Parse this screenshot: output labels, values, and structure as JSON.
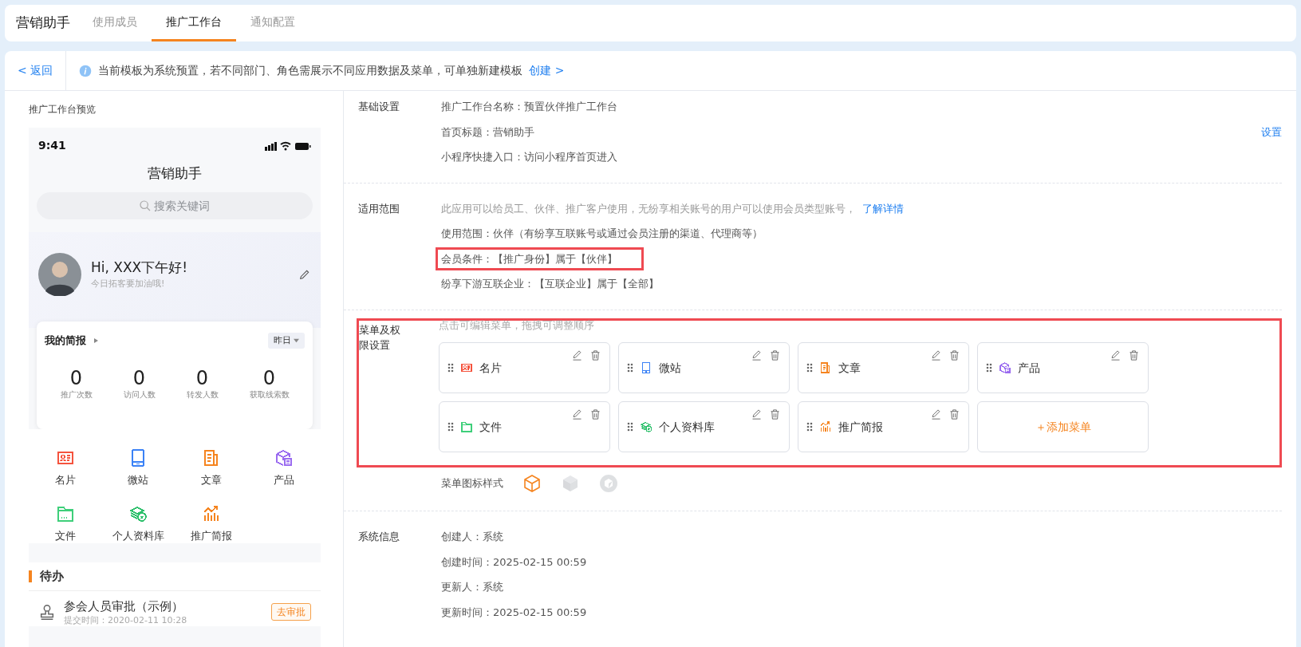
{
  "app_title": "营销助手",
  "tabs": [
    {
      "label": "使用成员",
      "selected": false
    },
    {
      "label": "推广工作台",
      "selected": true
    },
    {
      "label": "通知配置",
      "selected": false
    }
  ],
  "back": "< 返回",
  "notice": {
    "text": "当前模板为系统预置，若不同部门、角色需展示不同应用数据及菜单，可单独新建模板",
    "link": "创建 >"
  },
  "preview": {
    "label": "推广工作台预览",
    "time": "9:41",
    "title": "营销助手",
    "search_placeholder": "搜索关键词",
    "greeting": "Hi, XXX下午好!",
    "subtitle": "今日拓客要加油哦!",
    "report": {
      "title": "我的简报",
      "period": "昨日",
      "stats": [
        {
          "value": "0",
          "label": "推广次数"
        },
        {
          "value": "0",
          "label": "访问人数"
        },
        {
          "value": "0",
          "label": "转发人数"
        },
        {
          "value": "0",
          "label": "获取线索数"
        }
      ]
    },
    "menu": [
      {
        "label": "名片",
        "kind": "card",
        "color": "#f5533d"
      },
      {
        "label": "微站",
        "kind": "phone",
        "color": "#3b82f6"
      },
      {
        "label": "文章",
        "kind": "article",
        "color": "#f5841f"
      },
      {
        "label": "产品",
        "kind": "product",
        "color": "#9b6cf0"
      },
      {
        "label": "文件",
        "kind": "folder",
        "color": "#3ecf7a"
      },
      {
        "label": "个人资料库",
        "kind": "library",
        "color": "#2bbf6a"
      },
      {
        "label": "推广简报",
        "kind": "chart",
        "color": "#f5841f"
      }
    ],
    "todo": {
      "title": "待办",
      "items": [
        {
          "title": "参会人员审批（示例）",
          "time": "提交时间：2020-02-11 10:28",
          "action": "去审批"
        }
      ]
    }
  },
  "basic": {
    "title": "基础设置",
    "lines": [
      "推广工作台名称：预置伙伴推广工作台",
      "首页标题：营销助手",
      "小程序快捷入口：访问小程序首页进入"
    ],
    "action": "设置"
  },
  "scope": {
    "title": "适用范围",
    "hint": "此应用可以给员工、伙伴、推广客户使用，无纷享相关账号的用户可以使用会员类型账号，",
    "link": "了解详情",
    "lines": [
      {
        "text": "使用范围：伙伴（有纷享互联账号或通过会员注册的渠道、代理商等）",
        "highlighted": false
      },
      {
        "text": "会员条件：【推广身份】属于【伙伴】",
        "highlighted": true
      },
      {
        "text": "纷享下游互联企业：【互联企业】属于【全部】",
        "highlighted": false
      }
    ]
  },
  "menu_settings": {
    "title": "菜单及权限设置",
    "hint": "点击可编辑菜单，拖拽可调整顺序",
    "highlighted": true,
    "items": [
      {
        "label": "名片",
        "kind": "card",
        "color": "#f5533d"
      },
      {
        "label": "微站",
        "kind": "phone",
        "color": "#3b82f6"
      },
      {
        "label": "文章",
        "kind": "article",
        "color": "#f5841f"
      },
      {
        "label": "产品",
        "kind": "product",
        "color": "#9b6cf0"
      },
      {
        "label": "文件",
        "kind": "folder",
        "color": "#3ecf7a"
      },
      {
        "label": "个人资料库",
        "kind": "library",
        "color": "#2bbf6a"
      },
      {
        "label": "推广简报",
        "kind": "chart",
        "color": "#f5841f"
      }
    ],
    "add": "＋添加菜单",
    "icon_style_label": "菜单图标样式",
    "icon_styles": [
      {
        "kind": "outline",
        "selected": true
      },
      {
        "kind": "solid",
        "selected": false
      },
      {
        "kind": "round",
        "selected": false
      }
    ]
  },
  "system": {
    "title": "系统信息",
    "lines": [
      "创建人：系统",
      "创建时间：2025-02-15 00:59",
      "更新人：系统",
      "更新时间：2025-02-15 00:59"
    ]
  }
}
